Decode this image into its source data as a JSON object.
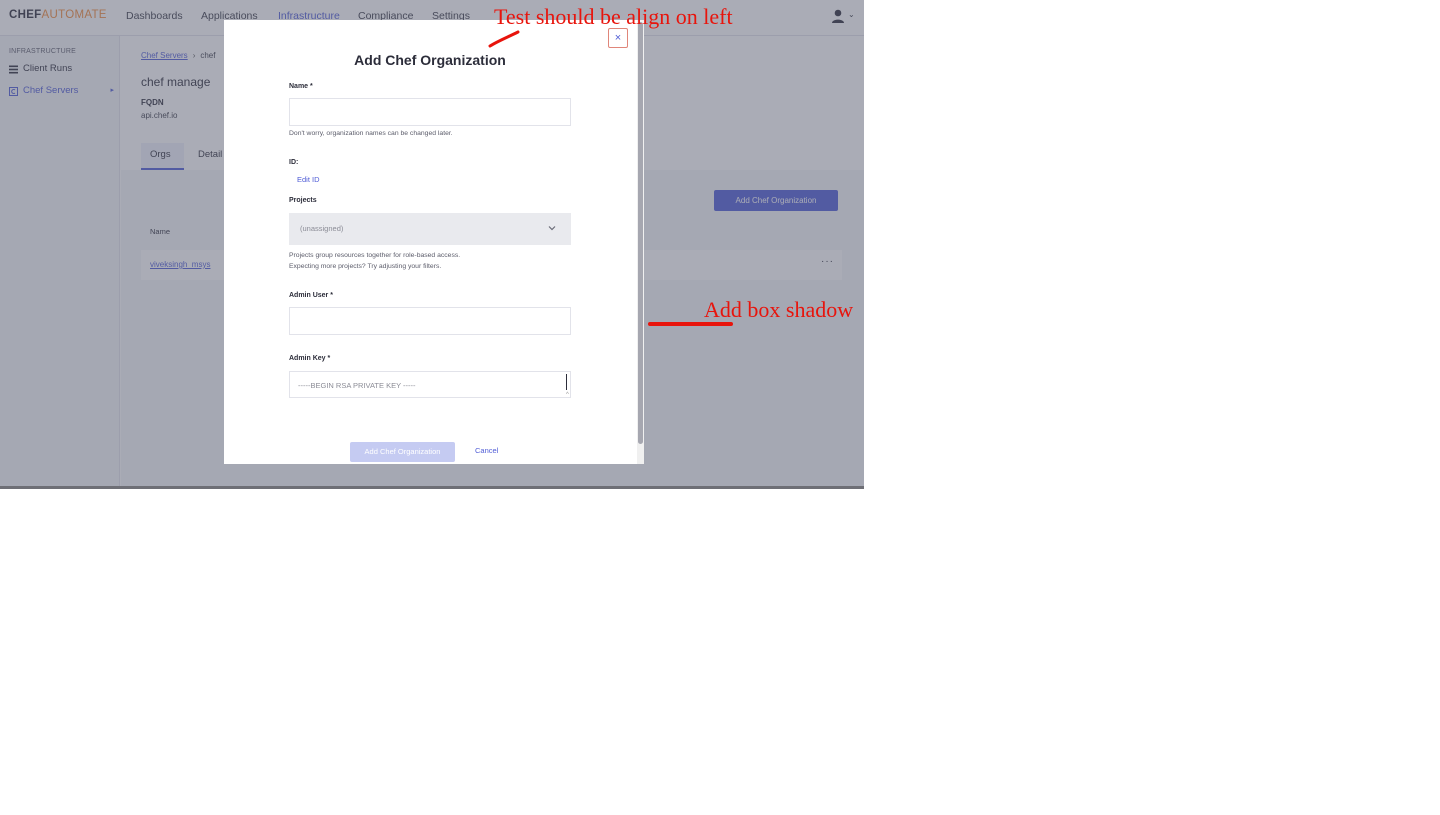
{
  "app": {
    "logo_primary": "CHEF",
    "logo_secondary": "AUTOMATE"
  },
  "topnav": {
    "items": [
      {
        "label": "Dashboards"
      },
      {
        "label": "Applications"
      },
      {
        "label": "Infrastructure",
        "active": true
      },
      {
        "label": "Compliance"
      },
      {
        "label": "Settings"
      }
    ],
    "user_icon": "person-icon",
    "chevron": "⌄"
  },
  "sidebar": {
    "heading": "INFRASTRUCTURE",
    "items": [
      {
        "label": "Client Runs",
        "icon": "list-icon"
      },
      {
        "label": "Chef Servers",
        "icon": "chef-server-icon",
        "active": true,
        "caret": "▸"
      }
    ]
  },
  "breadcrumb": {
    "link": "Chef Servers",
    "separator": "›",
    "current": "chef"
  },
  "page": {
    "title": "chef manage",
    "fqdn_label": "FQDN",
    "fqdn_value": "api.chef.io",
    "tabs": [
      {
        "label": "Orgs",
        "active": true
      },
      {
        "label": "Detail"
      }
    ],
    "add_button": "Add Chef Organization",
    "table": {
      "column_name": "Name",
      "rows": [
        {
          "name": "viveksingh_msys",
          "more": "···"
        }
      ]
    }
  },
  "modal": {
    "close_label": "×",
    "title": "Add Chef Organization",
    "name_label": "Name *",
    "name_value": "",
    "name_help": "Don't worry, organization names can be changed later.",
    "id_label": "ID:",
    "edit_id_label": "Edit ID",
    "projects_label": "Projects",
    "projects_value": "(unassigned)",
    "projects_help_1": "Projects group resources together for role-based access.",
    "projects_help_2": "Expecting more projects? Try adjusting your filters.",
    "admin_user_label": "Admin User *",
    "admin_user_value": "",
    "admin_key_label": "Admin Key *",
    "admin_key_placeholder": "-----BEGIN RSA PRIVATE KEY -----",
    "submit_label": "Add Chef Organization",
    "cancel_label": "Cancel"
  },
  "annotations": {
    "note_1": "Test should be align on left",
    "note_2": "Add box shadow",
    "color": "#e8140c"
  },
  "colors": {
    "accent": "#4f5cd6",
    "brand_orange": "#f28c3c",
    "overlay": "rgba(86,90,110,0.5)"
  }
}
